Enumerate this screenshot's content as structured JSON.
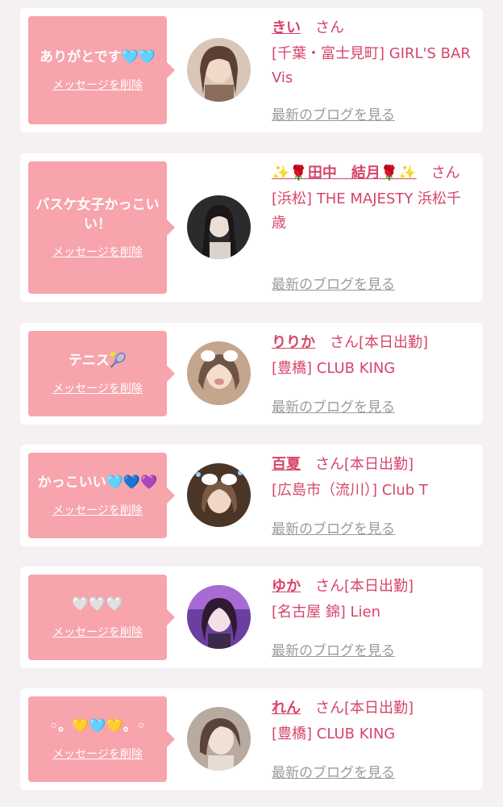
{
  "delete_label": "メッセージを削除",
  "blog_label": "最新のブログを見る",
  "honorific": "さん",
  "cards": [
    {
      "message": "ありがとです🩵🩵",
      "name": "きい",
      "status": "",
      "shop": "[千葉・富士見町] GIRL'S BAR Vis"
    },
    {
      "message": "バスケ女子かっこいい！",
      "name": "✨🌹田中　結月🌹✨",
      "status": "",
      "shop": "[浜松] THE MAJESTY 浜松千歳"
    },
    {
      "message": "テニス🎾",
      "name": "りりか",
      "status": "[本日出勤]",
      "shop": "[豊橋] CLUB KING"
    },
    {
      "message": "かっこいい🩵💙💜",
      "name": "百夏",
      "status": "[本日出勤]",
      "shop": "[広島市（流川）] Club T"
    },
    {
      "message": "🤍🤍🤍",
      "name": "ゆか",
      "status": "[本日出勤]",
      "shop": "[名古屋 錦] Lien"
    },
    {
      "message": "◦。💛🩵💛。◦",
      "name": "れん",
      "status": "[本日出勤]",
      "shop": "[豊橋] CLUB KING"
    }
  ]
}
